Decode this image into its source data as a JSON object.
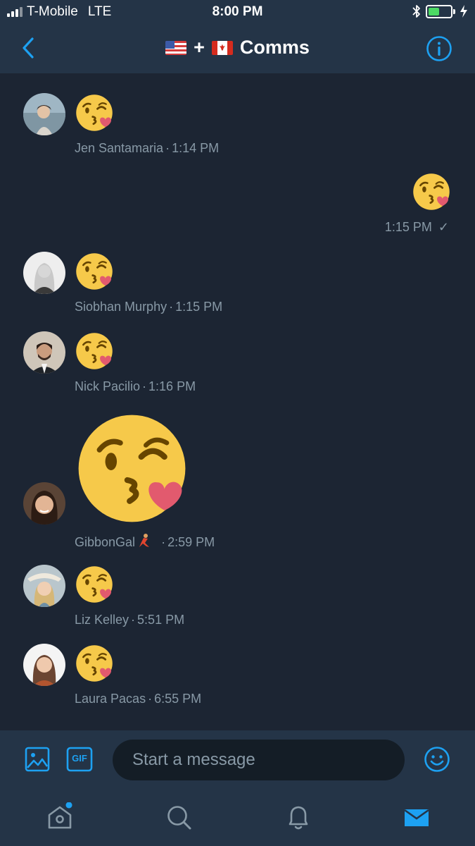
{
  "status_bar": {
    "carrier": "T-Mobile",
    "network": "LTE",
    "time": "8:00 PM",
    "battery_level": 0.5
  },
  "header": {
    "title": "Comms",
    "plus": "+",
    "back_icon": "chevron-left-icon",
    "info_icon": "info-circle-icon",
    "flags": [
      "us-flag-icon",
      "canada-flag-icon"
    ]
  },
  "messages": [
    {
      "sender": "Jen Santamaria",
      "time": "1:14 PM",
      "content": "kissing-face-emoji",
      "sep": "·"
    },
    {
      "sender": "",
      "time": "1:15 PM",
      "status": "✓",
      "content": "kissing-face-emoji",
      "outgoing": true
    },
    {
      "sender": "Siobhan Murphy",
      "time": "1:15 PM",
      "content": "kissing-face-emoji",
      "sep": "·"
    },
    {
      "sender": "Nick Pacilio",
      "time": "1:16 PM",
      "content": "kissing-face-emoji",
      "sep": "·"
    },
    {
      "sender": "GibbonGal",
      "time": "2:59 PM",
      "content": "kissing-face-emoji-large",
      "sep": "·",
      "badge": "dancer-emoji"
    },
    {
      "sender": "Liz Kelley",
      "time": "5:51 PM",
      "content": "kissing-face-emoji",
      "sep": "·"
    },
    {
      "sender": "Laura Pacas",
      "time": "6:55 PM",
      "content": "kissing-face-emoji",
      "sep": "·"
    }
  ],
  "composer": {
    "placeholder": "Start a message",
    "gif_label": "GIF"
  },
  "tabs": [
    "home-icon",
    "search-icon",
    "notifications-icon",
    "messages-icon"
  ],
  "colors": {
    "background": "#1c2533",
    "bar": "#243447",
    "accent": "#1da1f2",
    "secondary_text": "#8899a6",
    "emoji_face": "#f6c94a",
    "emoji_heart": "#e25a6e"
  }
}
